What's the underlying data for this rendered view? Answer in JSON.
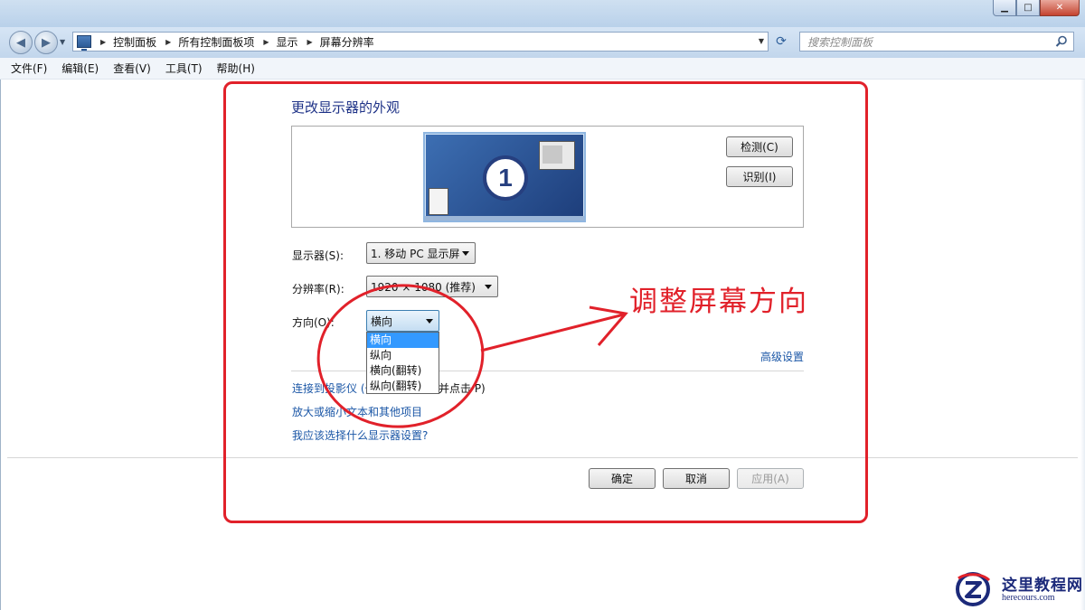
{
  "window": {
    "min_label": "▁",
    "max_label": "□",
    "close_label": "✕"
  },
  "nav": {
    "breadcrumbs": [
      "控制面板",
      "所有控制面板项",
      "显示",
      "屏幕分辨率"
    ],
    "search_placeholder": "搜索控制面板"
  },
  "menu": [
    "文件(F)",
    "编辑(E)",
    "查看(V)",
    "工具(T)",
    "帮助(H)"
  ],
  "main": {
    "heading": "更改显示器的外观",
    "monitor_number": "1",
    "detect_label": "检测(C)",
    "identify_label": "识别(I)",
    "display_label": "显示器(S):",
    "display_value": "1. 移动 PC 显示屏",
    "resolution_label": "分辨率(R):",
    "resolution_value": "1920 × 1080 (推荐)",
    "orientation_label": "方向(O):",
    "orientation_value": "横向",
    "orientation_options": [
      "横向",
      "纵向",
      "横向(翻转)",
      "纵向(翻转)"
    ],
    "advanced_link": "高级设置",
    "links": [
      "连接到投影仪 (也可按下",
      "并点击 P)",
      "放大或缩小文本和其他项目",
      "我应该选择什么显示器设置?"
    ],
    "ok_label": "确定",
    "cancel_label": "取消",
    "apply_label": "应用(A)"
  },
  "annotation": {
    "text": "调整屏幕方向",
    "color": "#e1212a"
  },
  "watermark": {
    "title": "这里教程网",
    "url": "herecours.com"
  }
}
